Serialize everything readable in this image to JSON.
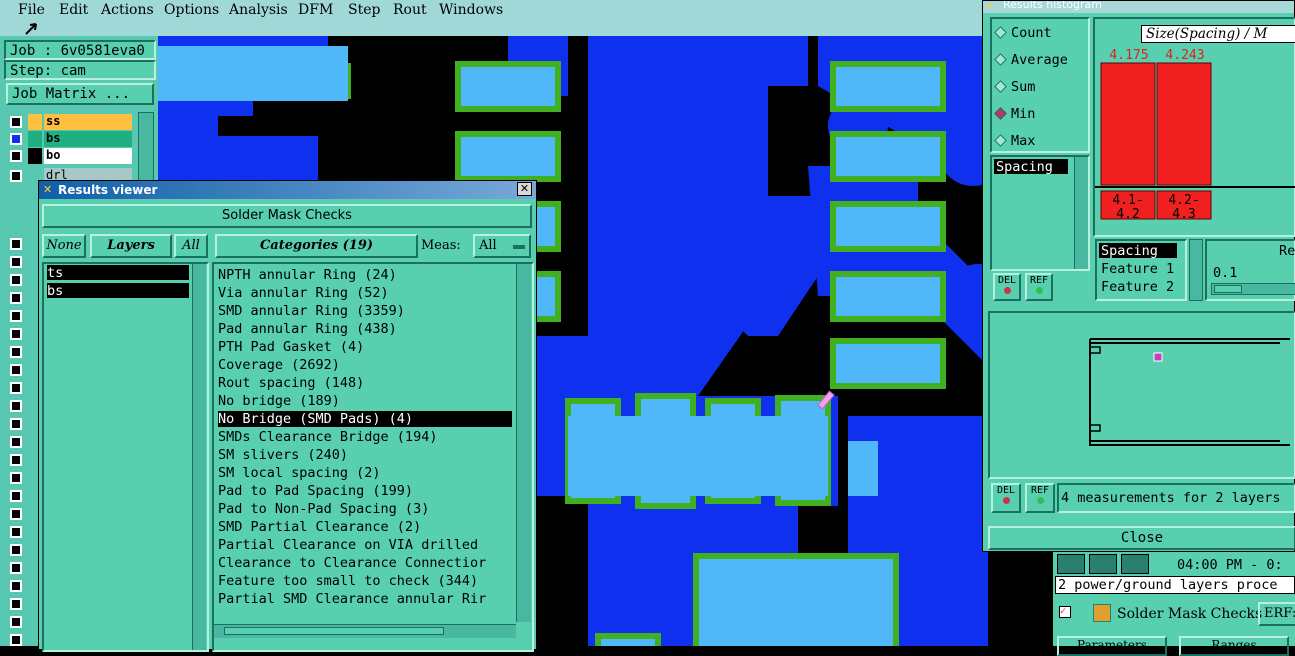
{
  "menu": [
    "File",
    "Edit",
    "Actions",
    "Options",
    "Analysis",
    "DFM",
    "Step",
    "Rout",
    "Windows"
  ],
  "left": {
    "job": "Job : 6v0581eva0",
    "step": "Step: cam",
    "job_matrix": "Job Matrix ...",
    "layers": [
      {
        "name": "ss",
        "color": "#ffc040"
      },
      {
        "name": "bs",
        "color": "#20b080"
      },
      {
        "name": "bo",
        "color": "#ffffff"
      },
      {
        "name": "drl",
        "color": "#a8c8c8"
      }
    ]
  },
  "results_viewer": {
    "title": "Results viewer",
    "header": "Solder Mask Checks",
    "btn_none": "None",
    "btn_layers": "Layers",
    "btn_all": "All",
    "categories_label": "Categories (19)",
    "meas_label": "Meas:",
    "meas_value": "All",
    "layers": [
      "ts",
      "bs"
    ],
    "categories": [
      "NPTH annular Ring (24)",
      "Via annular Ring (52)",
      "SMD annular Ring (3359)",
      "Pad annular Ring (438)",
      "PTH Pad Gasket (4)",
      "Coverage (2692)",
      "Rout spacing (148)",
      "No bridge (189)",
      "No Bridge (SMD Pads) (4)",
      "SMDs Clearance Bridge (194)",
      "SM slivers (240)",
      "SM local spacing (2)",
      "Pad to Pad Spacing (199)",
      "Pad to Non-Pad Spacing (3)",
      "SMD Partial Clearance (2)",
      "Partial Clearance on VIA drilled",
      "Clearance to Clearance Connectior",
      "Feature too small to check (344)",
      "Partial SMD Clearance annular Rir"
    ],
    "selected_index": 8
  },
  "histogram": {
    "title": "Results histogram",
    "radios": [
      "Count",
      "Average",
      "Sum",
      "Min",
      "Max"
    ],
    "selected_radio": "Min",
    "list_item": "Spacing",
    "chart_title": "Size(Spacing) / M",
    "bar_values": [
      "4.175",
      "4.243"
    ],
    "bar_labels": [
      [
        "4.1-",
        "4.2"
      ],
      [
        "4.2-",
        "4.3"
      ]
    ],
    "attrs": [
      "Spacing",
      "Feature 1",
      "Feature 2"
    ],
    "slider_label": "Re",
    "slider_value": "0.1",
    "del": "DEL",
    "ref": "REF",
    "summary": "4 measurements for 2 layers",
    "close": "Close"
  },
  "bottom_right": {
    "time": "04:00 PM - 0:",
    "message": "2 power/ground layers proce",
    "item": "Solder Mask Checks",
    "erf": "ERF:",
    "tab1": "Parameters",
    "tab2": "Ranges"
  }
}
